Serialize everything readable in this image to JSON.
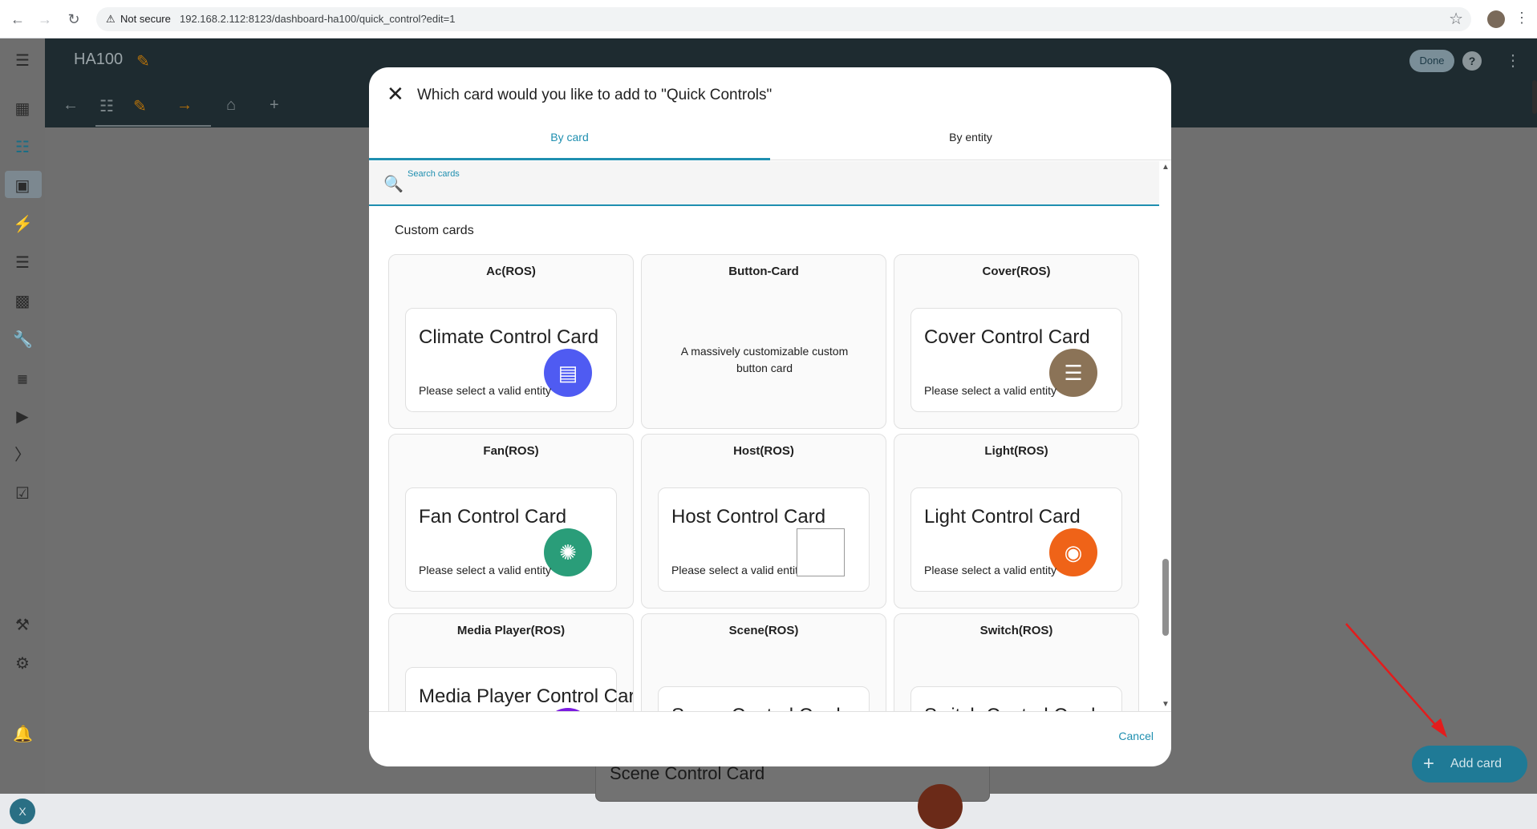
{
  "browser": {
    "security_label": "Not secure",
    "url": "192.168.2.112:8123/dashboard-ha100/quick_control?edit=1",
    "back_icon": "arrow-left-icon",
    "forward_icon": "arrow-right-icon",
    "reload_icon": "reload-icon"
  },
  "sidebar": {
    "avatar_letter": "X",
    "items": [
      "overview",
      "remote",
      "map",
      "energy",
      "logbook",
      "history",
      "tools",
      "hacs",
      "media",
      "terminal",
      "todo",
      "developer-tools",
      "settings",
      "notifications"
    ]
  },
  "app": {
    "title": "HA100",
    "done_label": "Done",
    "help_label": "?"
  },
  "dialog": {
    "title": "Which card would you like to add to \"Quick Controls\"",
    "tabs": [
      {
        "label": "By card",
        "active": true
      },
      {
        "label": "By entity",
        "active": false
      }
    ],
    "search_placeholder": "Search cards",
    "section_title": "Custom cards",
    "cards": [
      {
        "name": "Ac(ROS)",
        "title": "Climate Control Card",
        "subtitle": "Please select a valid entity",
        "icon": "air-conditioner-icon",
        "color": "#4f5bf2"
      },
      {
        "name": "Button-Card",
        "description": "A massively customizable custom button card"
      },
      {
        "name": "Cover(ROS)",
        "title": "Cover Control Card",
        "subtitle": "Please select a valid entity",
        "icon": "blinds-icon",
        "color": "#8b7357"
      },
      {
        "name": "Fan(ROS)",
        "title": "Fan Control Card",
        "subtitle": "Please select a valid entity",
        "icon": "fan-icon",
        "color": "#2a9d79"
      },
      {
        "name": "Host(ROS)",
        "title": "Host Control Card",
        "subtitle": "Please select a valid entity",
        "icon": "broken-image-icon"
      },
      {
        "name": "Light(ROS)",
        "title": "Light Control Card",
        "subtitle": "Please select a valid entity",
        "icon": "lightbulb-icon",
        "color": "#ef6318"
      },
      {
        "name": "Media Player(ROS)",
        "title": "Media Player Control Card",
        "icon": "media-player-icon",
        "color": "#7b1ce0"
      },
      {
        "name": "Scene(ROS)",
        "title": "Scene Control Card",
        "icon": "scene-icon",
        "color": "#c0331c"
      },
      {
        "name": "Switch(ROS)",
        "title": "Switch Control Card",
        "icon": "switch-icon",
        "color": "#2a9d3f"
      }
    ],
    "cancel_label": "Cancel"
  },
  "background": {
    "card_title": "Scene Control Card"
  },
  "fab": {
    "label": "Add card"
  },
  "colors": {
    "accent": "#1f8fb0",
    "appbar": "#1e2b30",
    "fab": "#1f7a96",
    "arrow": "#e31c1c"
  }
}
